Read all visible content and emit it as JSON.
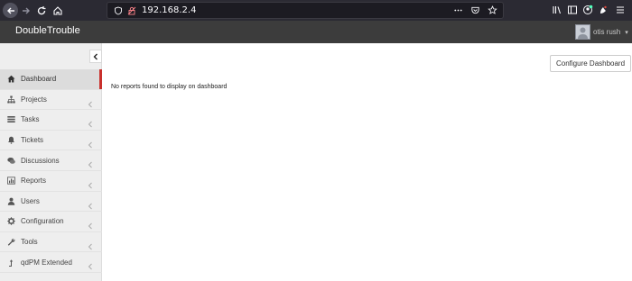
{
  "browser": {
    "url": "192.168.2.4",
    "icons": [
      "back-icon",
      "forward-icon",
      "reload-icon",
      "home-icon",
      "shield-icon",
      "insecure-lock-icon",
      "more-icon",
      "pocket-icon",
      "bookmark-star-icon",
      "library-icon",
      "sidebar-icon",
      "account-icon",
      "extension-icon",
      "menu-icon"
    ]
  },
  "app": {
    "title": "DoubleTrouble",
    "user": {
      "name": "otis rush"
    }
  },
  "sidebar": {
    "items": [
      {
        "label": "Dashboard",
        "icon": "home-icon",
        "active": true,
        "has_submenu": false
      },
      {
        "label": "Projects",
        "icon": "sitemap-icon",
        "active": false,
        "has_submenu": true
      },
      {
        "label": "Tasks",
        "icon": "tasks-list-icon",
        "active": false,
        "has_submenu": true
      },
      {
        "label": "Tickets",
        "icon": "bell-icon",
        "active": false,
        "has_submenu": true
      },
      {
        "label": "Discussions",
        "icon": "comments-icon",
        "active": false,
        "has_submenu": true
      },
      {
        "label": "Reports",
        "icon": "bar-chart-icon",
        "active": false,
        "has_submenu": true
      },
      {
        "label": "Users",
        "icon": "user-icon",
        "active": false,
        "has_submenu": true
      },
      {
        "label": "Configuration",
        "icon": "gear-icon",
        "active": false,
        "has_submenu": true
      },
      {
        "label": "Tools",
        "icon": "wrench-icon",
        "active": false,
        "has_submenu": true
      },
      {
        "label": "qdPM Extended",
        "icon": "level-up-icon",
        "active": false,
        "has_submenu": true
      }
    ]
  },
  "main": {
    "configure_label": "Configure Dashboard",
    "empty_message": "No reports found to display on dashboard"
  },
  "colors": {
    "browser_chrome": "#2b2a33",
    "app_header": "#3c3c3c",
    "sidebar_bg": "#eeeeee",
    "active_accent": "#c9302c"
  }
}
